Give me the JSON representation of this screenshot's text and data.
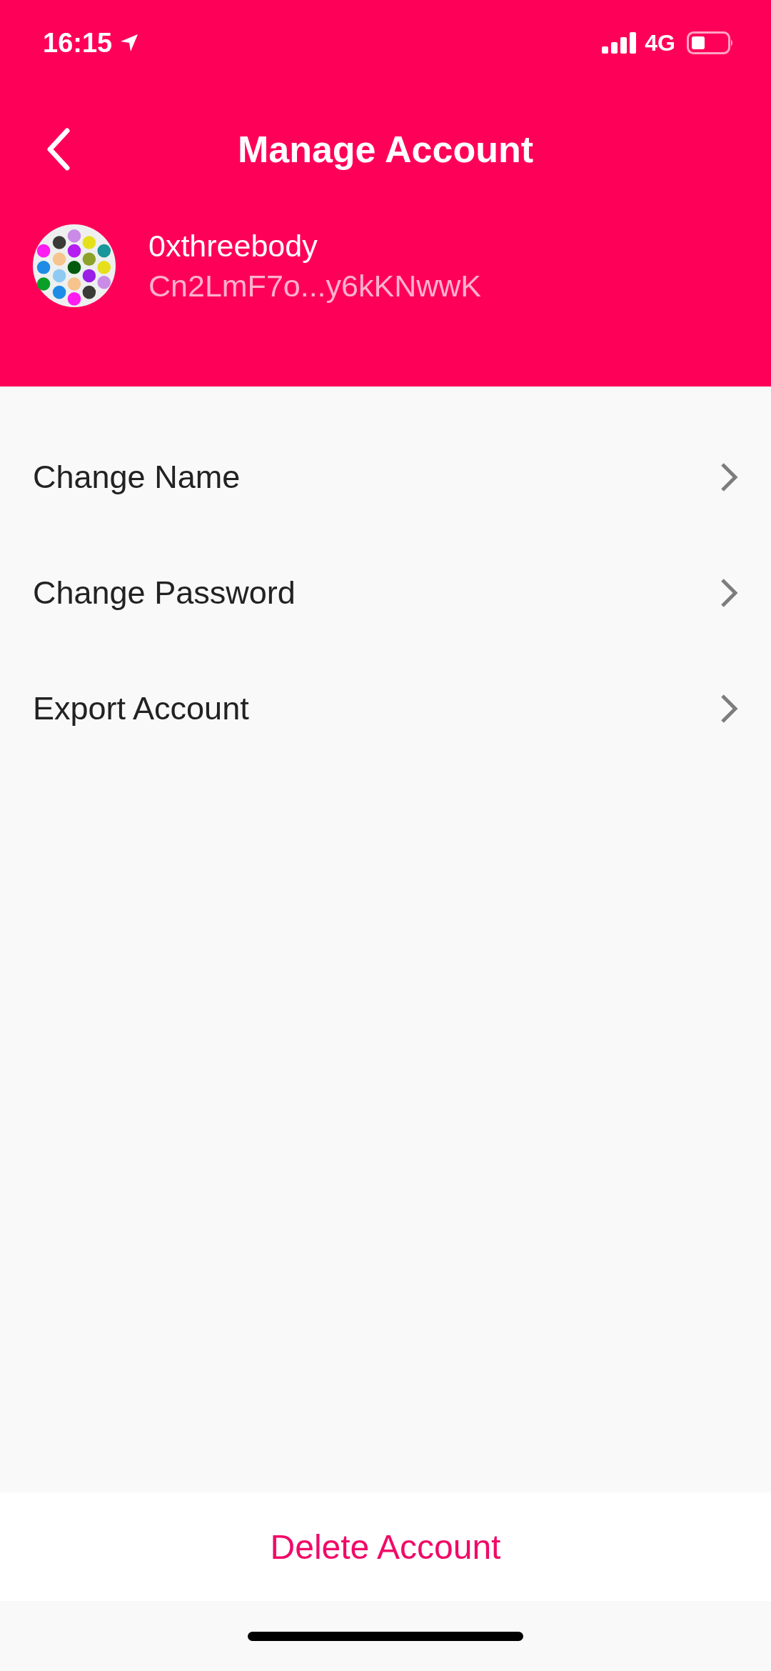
{
  "status_bar": {
    "time": "16:15",
    "network": "4G"
  },
  "header": {
    "title": "Manage Account"
  },
  "account": {
    "name": "0xthreebody",
    "address": "Cn2LmF7o...y6kKNwwK"
  },
  "menu": [
    {
      "label": "Change Name"
    },
    {
      "label": "Change Password"
    },
    {
      "label": "Export Account"
    }
  ],
  "footer_button": {
    "label": "Delete Account"
  }
}
